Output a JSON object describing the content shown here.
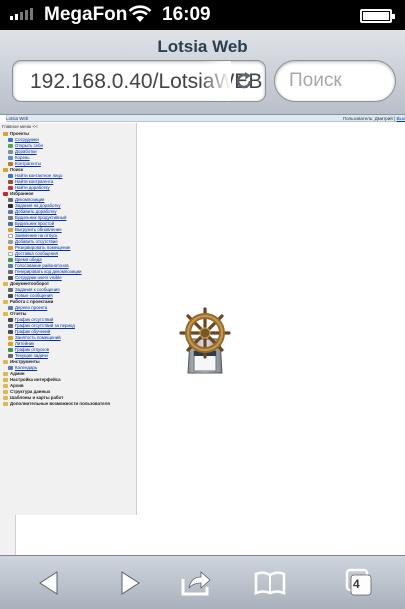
{
  "status_bar": {
    "carrier": "MegaFon",
    "time": "16:09",
    "signal_bars": 2
  },
  "browser": {
    "title": "Lotsia Web",
    "url": "192.168.0.40/LotsiaWEB",
    "search_placeholder": "Поиск",
    "tabs_count": "4"
  },
  "app": {
    "brand": "Lotsia Web",
    "user_label": "Пользователь: Дмитрий",
    "user_action": "Вых",
    "menu_title": "Главное меню <<"
  },
  "menu": [
    {
      "label": "Проекты",
      "type": "group",
      "color": "#d9a520"
    },
    {
      "label": "Сотрудники",
      "type": "link",
      "color": "#3a76c4"
    },
    {
      "label": "Открыть себя",
      "type": "link",
      "color": "#5aa34a"
    },
    {
      "label": "Доработки",
      "type": "link",
      "color": "#7a8fb0"
    },
    {
      "label": "Корень",
      "type": "link",
      "color": "#5a8fd0"
    },
    {
      "label": "Контрагенты",
      "type": "link",
      "color": "#c0772c"
    },
    {
      "label": "Поиск",
      "type": "group",
      "color": "#d9a520"
    },
    {
      "label": "Найти контактное лицо",
      "type": "link",
      "color": "#3a76c4"
    },
    {
      "label": "Найти контрагента",
      "type": "link",
      "color": "#a04a2a"
    },
    {
      "label": "Найти доработку",
      "type": "link",
      "color": "#b04040"
    },
    {
      "label": "Избранное",
      "type": "group",
      "color": "#cc2222"
    },
    {
      "label": "Декомпозиция",
      "type": "link",
      "color": "#6a6a6a"
    },
    {
      "label": "Задания на доработку",
      "type": "link",
      "color": "#2c2c2c"
    },
    {
      "label": "Добавить доработку",
      "type": "link",
      "color": "#5a7ab0"
    },
    {
      "label": "Будильник продуктивный",
      "type": "link",
      "color": "#777777"
    },
    {
      "label": "Будильник простой",
      "type": "link",
      "color": "#4a6aa0"
    },
    {
      "label": "Выгрузить обновление",
      "type": "link",
      "color": "#d9a520"
    },
    {
      "label": "Заявление на отпуск",
      "type": "link",
      "color": "#ffffff"
    },
    {
      "label": "Добавить отсутствие",
      "type": "link",
      "color": "#9a9a9a"
    },
    {
      "label": "Резервировать помещение",
      "type": "link",
      "color": "#e09a2a"
    },
    {
      "label": "Доставка сообщения",
      "type": "link",
      "color": "#ffffff"
    },
    {
      "label": "Время обеда",
      "type": "link",
      "color": "#3a9a4a"
    },
    {
      "label": "Голосование районатонов",
      "type": "link",
      "color": "#5a7ab0"
    },
    {
      "label": "Генерировать код декомпозиции",
      "type": "link",
      "color": "#6a6a6a"
    },
    {
      "label": "Сотрудник users visible",
      "type": "link",
      "color": "#4a4a4a"
    },
    {
      "label": "Документооборот",
      "type": "group",
      "color": "#e0b84a"
    },
    {
      "label": "Задания к сообщения",
      "type": "link",
      "color": "#6a6a6a"
    },
    {
      "label": "Новые сообщения",
      "type": "link",
      "color": "#4a4a4a"
    },
    {
      "label": "Работа с проектами",
      "type": "group",
      "color": "#e0b84a"
    },
    {
      "label": "Дерево проекта",
      "type": "link",
      "color": "#5a7ab0"
    },
    {
      "label": "Отчеты",
      "type": "group",
      "color": "#e0b84a"
    },
    {
      "label": "График отсутствий",
      "type": "link",
      "color": "#4a4a4a"
    },
    {
      "label": "График отсутствий за период",
      "type": "link",
      "color": "#5a6a7a"
    },
    {
      "label": "График обучений",
      "type": "link",
      "color": "#4a4a4a"
    },
    {
      "label": "Занятость помещений",
      "type": "link",
      "color": "#e09a2a"
    },
    {
      "label": "Литейник",
      "type": "link",
      "color": "#e0a020"
    },
    {
      "label": "График отпусков",
      "type": "link",
      "color": "#3a9a4a"
    },
    {
      "label": "Текущие задачи",
      "type": "link",
      "color": "#6a6a6a"
    },
    {
      "label": "Инструменты",
      "type": "group",
      "color": "#e0b84a"
    },
    {
      "label": "Календарь",
      "type": "link",
      "color": "#5a7ab0"
    },
    {
      "label": "Админ",
      "type": "group",
      "color": "#e0b84a"
    },
    {
      "label": "Настройка интерфейса",
      "type": "group",
      "color": "#e0b84a"
    },
    {
      "label": "Архив",
      "type": "group",
      "color": "#e0b84a"
    },
    {
      "label": "Структура данных",
      "type": "group",
      "color": "#e0b84a"
    },
    {
      "label": "Шаблоны и карты работ",
      "type": "group",
      "color": "#e0b84a"
    },
    {
      "label": "Дополнительные возможности пользователя",
      "type": "group",
      "color": "#e0b84a"
    }
  ]
}
